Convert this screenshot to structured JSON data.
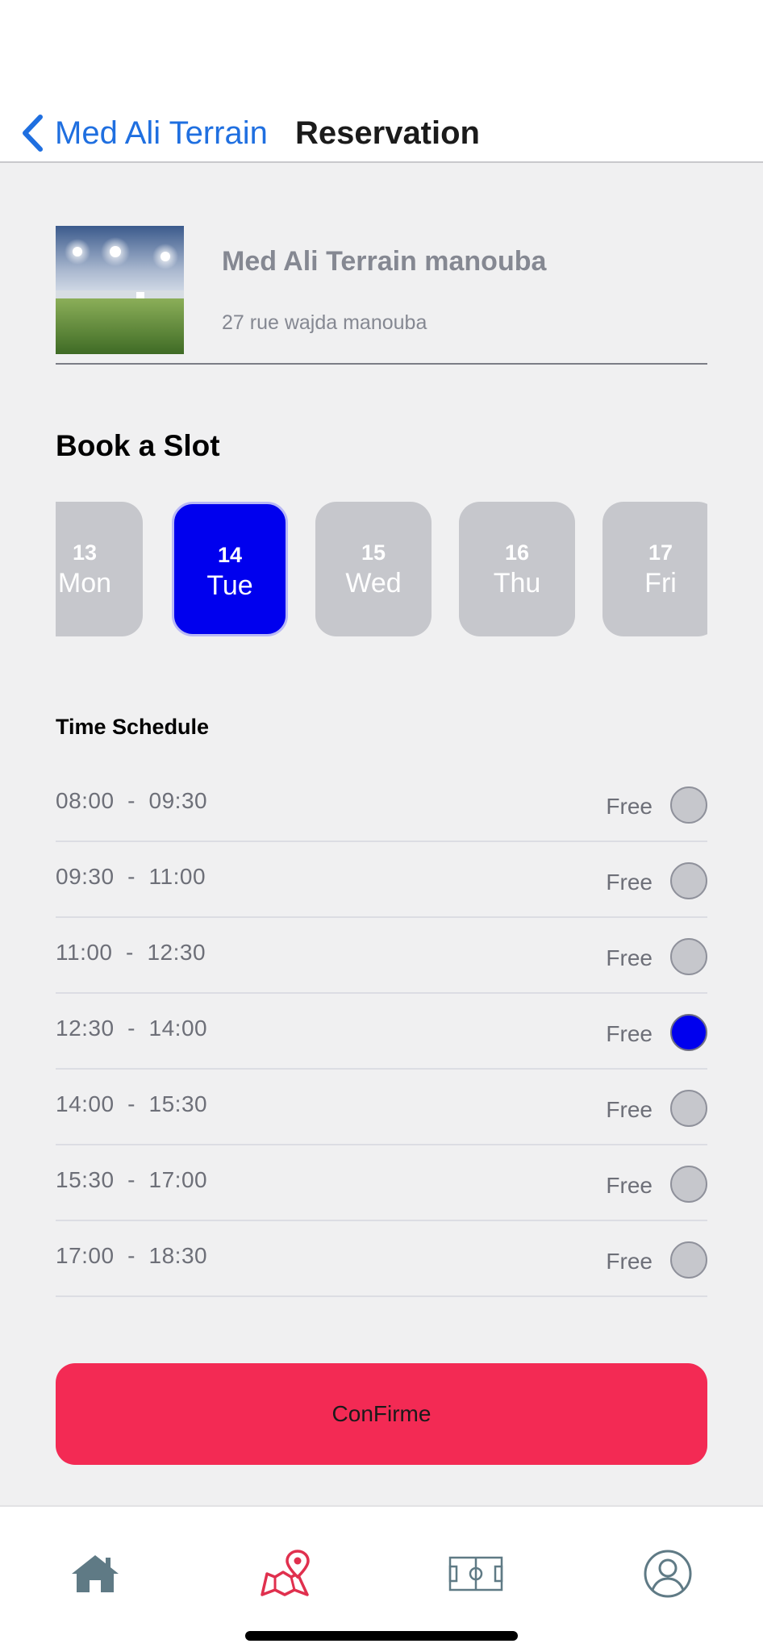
{
  "nav": {
    "back_label": "Med Ali Terrain",
    "title": "Reservation"
  },
  "venue": {
    "name": "Med Ali Terrain manouba",
    "address": "27 rue wajda manouba",
    "photo_icon": "football-pitch-photo"
  },
  "booking": {
    "title": "Book a Slot",
    "selected_day": "14",
    "days": [
      {
        "num": "13",
        "name": "Mon"
      },
      {
        "num": "14",
        "name": "Tue"
      },
      {
        "num": "15",
        "name": "Wed"
      },
      {
        "num": "16",
        "name": "Thu"
      },
      {
        "num": "17",
        "name": "Fri"
      }
    ]
  },
  "schedule": {
    "title": "Time Schedule",
    "slots": [
      {
        "start": "08:00",
        "end": "09:30",
        "status": "Free",
        "selected": false
      },
      {
        "start": "09:30",
        "end": "11:00",
        "status": "Free",
        "selected": false
      },
      {
        "start": "11:00",
        "end": "12:30",
        "status": "Free",
        "selected": false
      },
      {
        "start": "12:30",
        "end": "14:00",
        "status": "Free",
        "selected": true
      },
      {
        "start": "14:00",
        "end": "15:30",
        "status": "Free",
        "selected": false
      },
      {
        "start": "15:30",
        "end": "17:00",
        "status": "Free",
        "selected": false
      },
      {
        "start": "17:00",
        "end": "18:30",
        "status": "Free",
        "selected": false
      }
    ]
  },
  "confirm": {
    "label": "ConFirme"
  },
  "tabs": [
    {
      "name": "home",
      "icon": "home-icon",
      "active": false
    },
    {
      "name": "map",
      "icon": "map-pin-icon",
      "active": true
    },
    {
      "name": "field",
      "icon": "football-field-icon",
      "active": false
    },
    {
      "name": "profile",
      "icon": "user-icon",
      "active": false
    }
  ],
  "colors": {
    "accent_blue": "#0000ee",
    "link_blue": "#1f6fe0",
    "confirm_red": "#f32a54",
    "active_tab": "#e0304e",
    "inactive_tab": "#5f7a85",
    "unselected_gray": "#c6c7cc"
  }
}
